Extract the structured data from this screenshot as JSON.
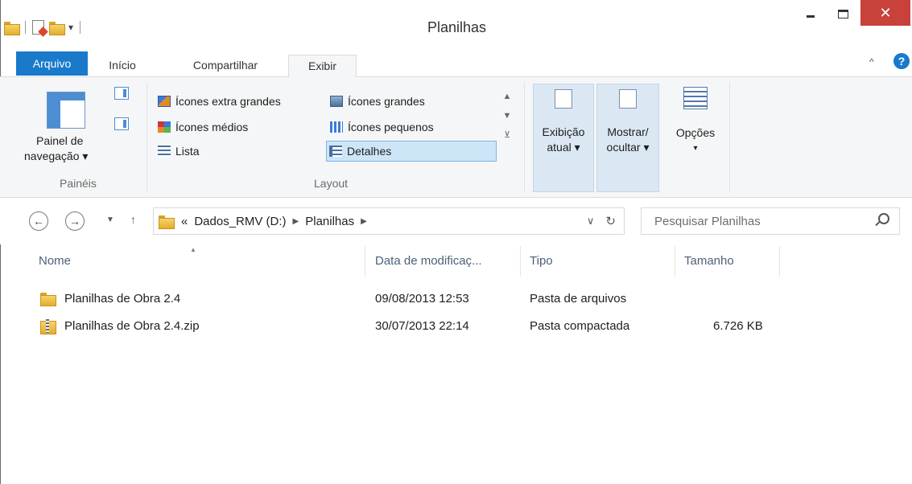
{
  "window": {
    "title": "Planilhas",
    "close_glyph": "✕"
  },
  "ribbon_tabs": [
    {
      "label": "Arquivo"
    },
    {
      "label": "Início"
    },
    {
      "label": "Compartilhar"
    },
    {
      "label": "Exibir"
    }
  ],
  "ribbon": {
    "panes_group": {
      "nav_pane_label_line1": "Painel de",
      "nav_pane_label_line2": "navegação ▾",
      "group_label": "Painéis"
    },
    "layout_group": {
      "items": [
        {
          "label": "Ícones extra grandes",
          "icon": "extra-large-icons-icon"
        },
        {
          "label": "Ícones grandes",
          "icon": "large-icons-icon"
        },
        {
          "label": "Ícones médios",
          "icon": "medium-icons-icon"
        },
        {
          "label": "Ícones pequenos",
          "icon": "small-icons-icon"
        },
        {
          "label": "Lista",
          "icon": "list-icon"
        },
        {
          "label": "Detalhes",
          "icon": "details-icon",
          "selected": true
        }
      ],
      "group_label": "Layout"
    },
    "current_view": {
      "line1": "Exibição",
      "line2": "atual ▾"
    },
    "show_hide": {
      "line1": "Mostrar/",
      "line2": "ocultar ▾"
    },
    "options": {
      "line1": "Opções",
      "line2": "▾"
    }
  },
  "address_bar": {
    "overflow": "«",
    "crumbs": [
      "Dados_RMV (D:)",
      "Planilhas"
    ],
    "search_placeholder": "Pesquisar Planilhas"
  },
  "columns": [
    {
      "label": "Nome"
    },
    {
      "label": "Data de modificaç..."
    },
    {
      "label": "Tipo"
    },
    {
      "label": "Tamanho"
    }
  ],
  "files": [
    {
      "name": "Planilhas de Obra 2.4",
      "modified": "09/08/2013 12:53",
      "type": "Pasta de arquivos",
      "size": "",
      "icon": "folder-icon"
    },
    {
      "name": "Planilhas de Obra 2.4.zip",
      "modified": "30/07/2013 22:14",
      "type": "Pasta compactada",
      "size": "6.726 KB",
      "icon": "zip-folder-icon"
    }
  ],
  "colors": {
    "accent": "#1979ca",
    "close_button": "#c8413a",
    "selection": "#cde6f7"
  }
}
